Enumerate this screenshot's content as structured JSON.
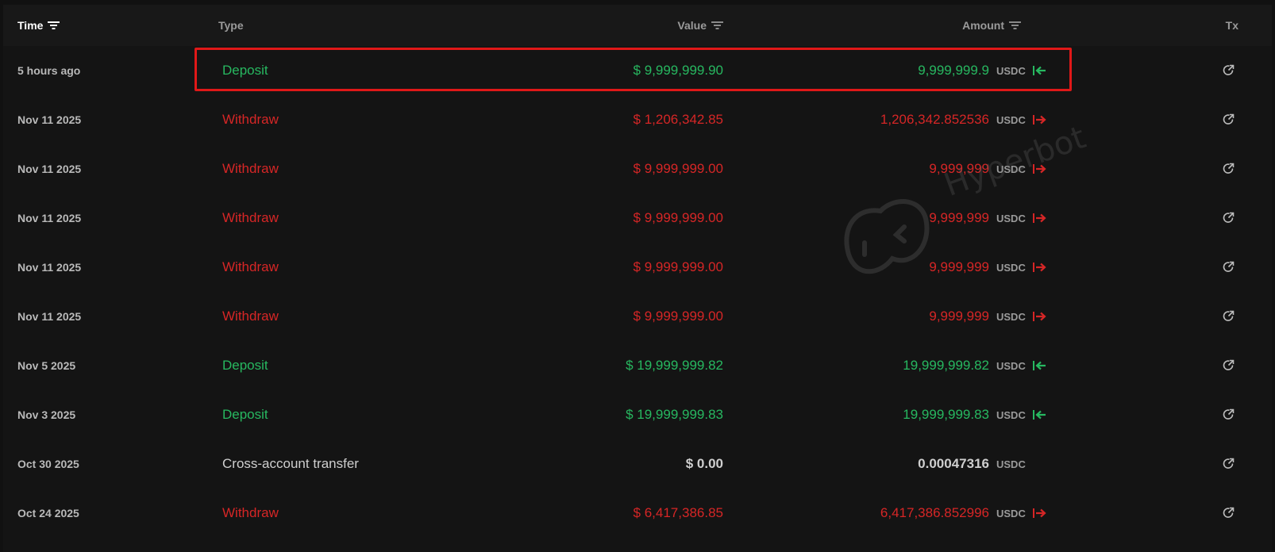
{
  "header": {
    "time": "Time",
    "type": "Type",
    "value": "Value",
    "amount": "Amount",
    "tx": "Tx"
  },
  "watermark": {
    "text": "Hyperbot"
  },
  "rows": [
    {
      "time": "5 hours ago",
      "type": "Deposit",
      "value": "$ 9,999,999.90",
      "amount": "9,999,999.9",
      "unit": "USDC",
      "direction": "in",
      "color": "green"
    },
    {
      "time": "Nov 11 2025",
      "type": "Withdraw",
      "value": "$ 1,206,342.85",
      "amount": "1,206,342.852536",
      "unit": "USDC",
      "direction": "out",
      "color": "red"
    },
    {
      "time": "Nov 11 2025",
      "type": "Withdraw",
      "value": "$ 9,999,999.00",
      "amount": "9,999,999",
      "unit": "USDC",
      "direction": "out",
      "color": "red"
    },
    {
      "time": "Nov 11 2025",
      "type": "Withdraw",
      "value": "$ 9,999,999.00",
      "amount": "9,999,999",
      "unit": "USDC",
      "direction": "out",
      "color": "red"
    },
    {
      "time": "Nov 11 2025",
      "type": "Withdraw",
      "value": "$ 9,999,999.00",
      "amount": "9,999,999",
      "unit": "USDC",
      "direction": "out",
      "color": "red"
    },
    {
      "time": "Nov 11 2025",
      "type": "Withdraw",
      "value": "$ 9,999,999.00",
      "amount": "9,999,999",
      "unit": "USDC",
      "direction": "out",
      "color": "red"
    },
    {
      "time": "Nov 5 2025",
      "type": "Deposit",
      "value": "$ 19,999,999.82",
      "amount": "19,999,999.82",
      "unit": "USDC",
      "direction": "in",
      "color": "green"
    },
    {
      "time": "Nov 3 2025",
      "type": "Deposit",
      "value": "$ 19,999,999.83",
      "amount": "19,999,999.83",
      "unit": "USDC",
      "direction": "in",
      "color": "green"
    },
    {
      "time": "Oct 30 2025",
      "type": "Cross-account transfer",
      "value": "$ 0.00",
      "amount": "0.00047316",
      "unit": "USDC",
      "direction": "none",
      "color": "neutral"
    },
    {
      "time": "Oct 24 2025",
      "type": "Withdraw",
      "value": "$ 6,417,386.85",
      "amount": "6,417,386.852996",
      "unit": "USDC",
      "direction": "out",
      "color": "red"
    }
  ],
  "colors": {
    "green": "#27b860",
    "red": "#d62626",
    "highlight": "#e01818",
    "background": "#141414"
  },
  "icons": {
    "filter": "filter-lines-icon",
    "tx": "external-link-refresh-icon",
    "in": "arrow-left-in-icon",
    "out": "arrow-right-out-icon"
  }
}
